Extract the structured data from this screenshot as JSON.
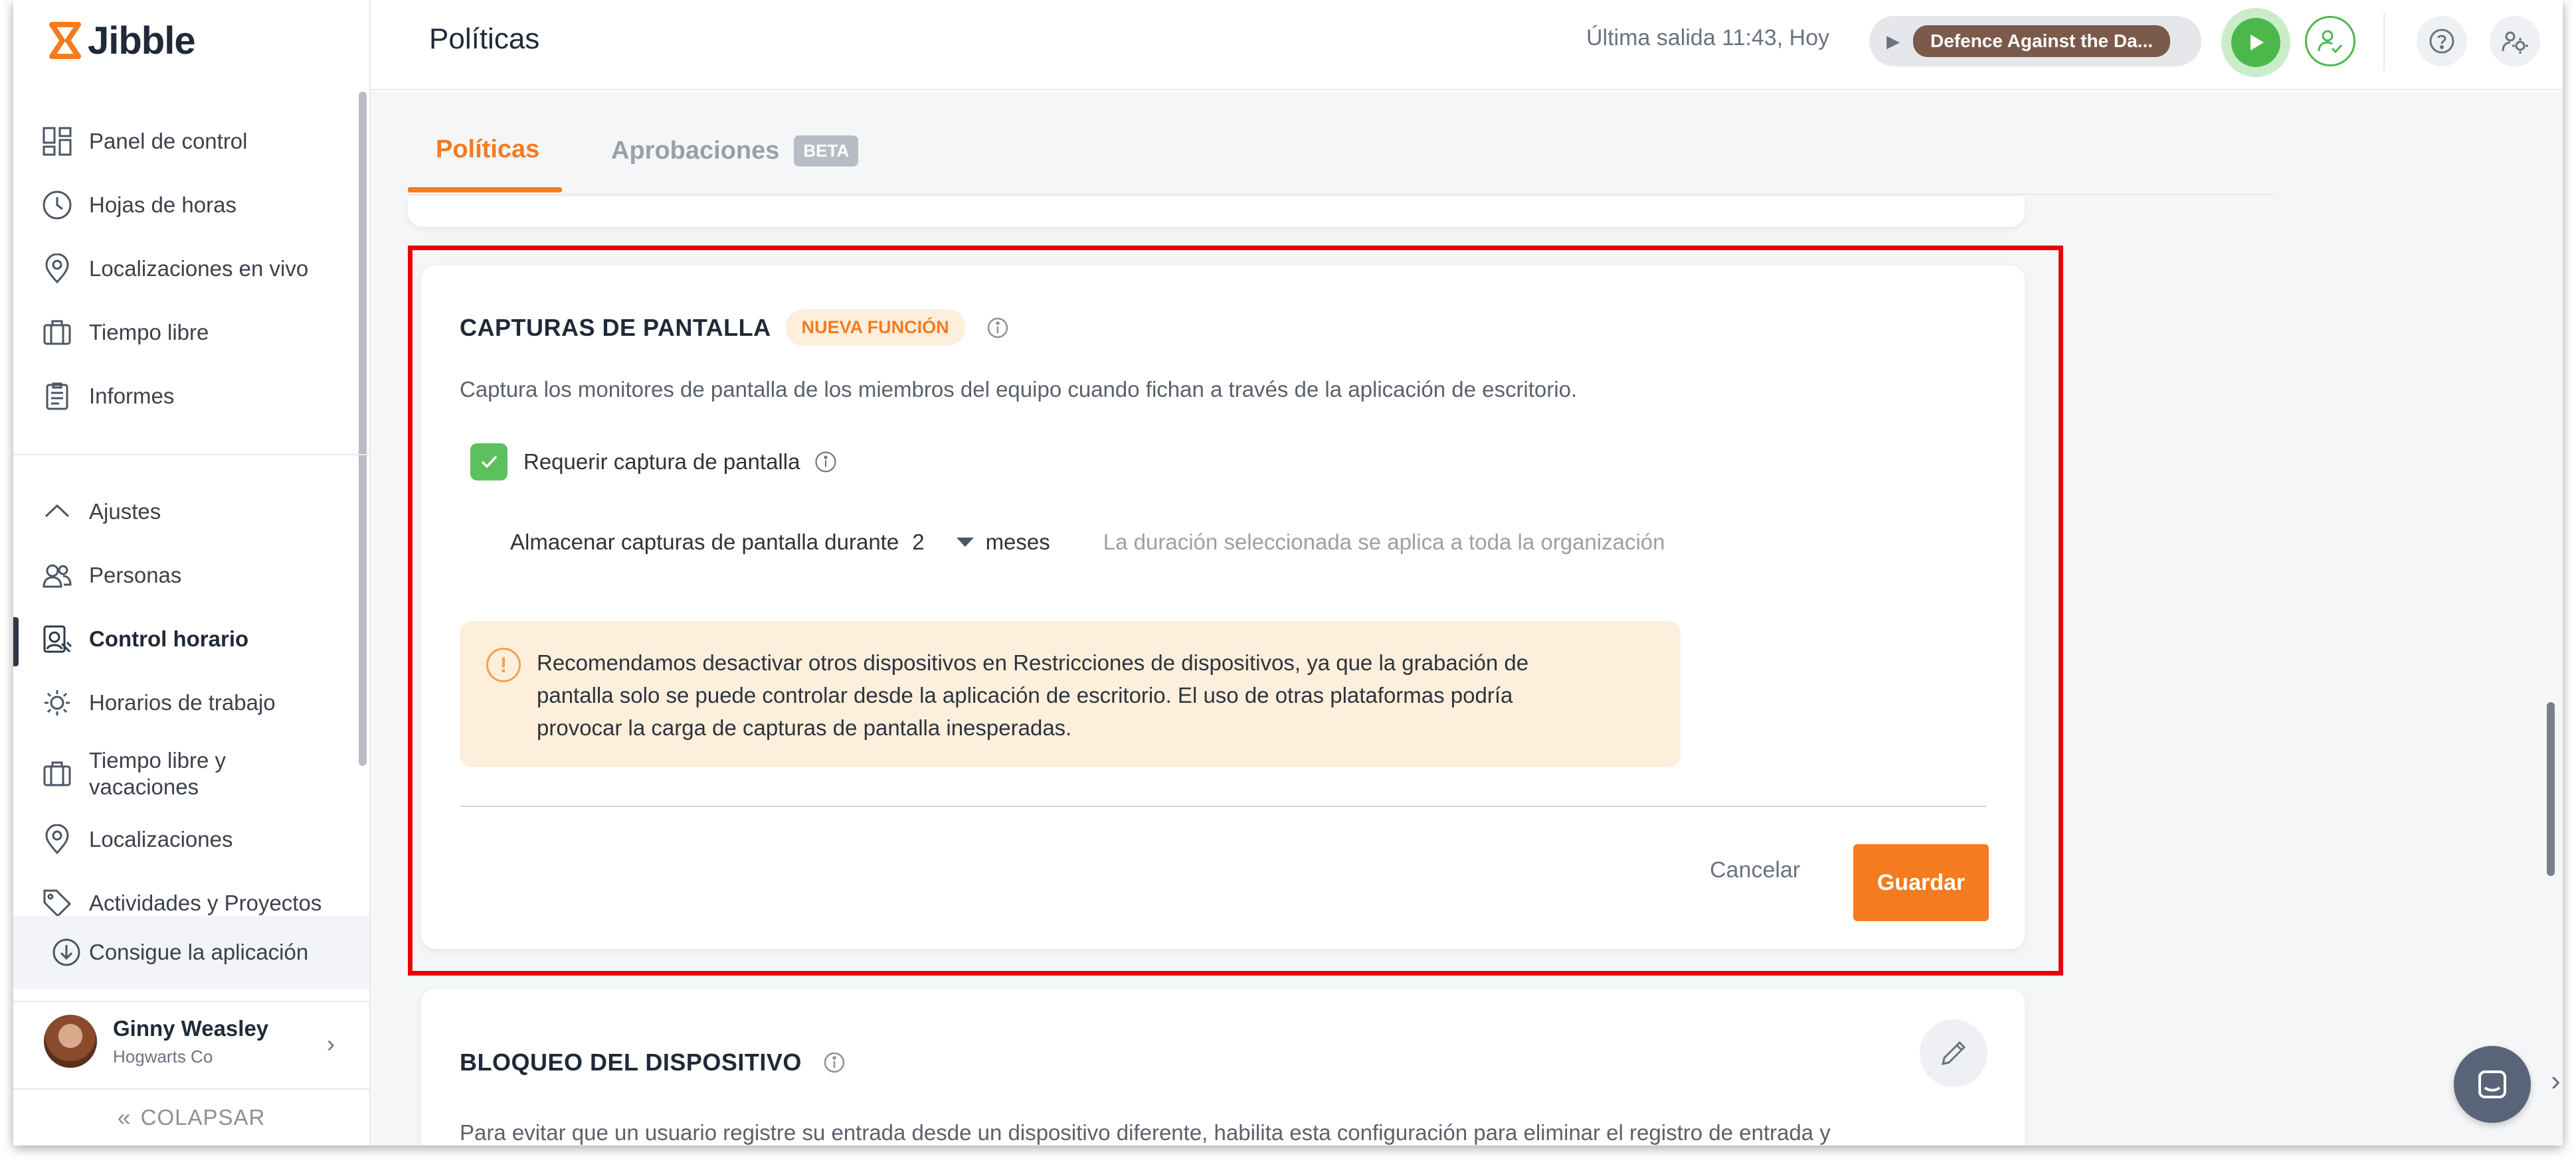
{
  "brand": {
    "name": "Jibble",
    "accent": "#f47b20"
  },
  "sidebar": {
    "items_top": [
      {
        "label": "Panel de control",
        "icon": "dashboard-icon"
      },
      {
        "label": "Hojas de horas",
        "icon": "clock-icon"
      },
      {
        "label": "Localizaciones en vivo",
        "icon": "location-pin-icon"
      },
      {
        "label": "Tiempo libre",
        "icon": "suitcase-icon"
      },
      {
        "label": "Informes",
        "icon": "clipboard-icon"
      }
    ],
    "items_settings": [
      {
        "label": "Ajustes",
        "icon": "chevron-up-icon"
      },
      {
        "label": "Personas",
        "icon": "people-icon"
      },
      {
        "label": "Control horario",
        "icon": "time-tracking-icon"
      },
      {
        "label": "Horarios de trabajo",
        "icon": "work-schedule-icon"
      },
      {
        "label": "Tiempo libre y vacaciones",
        "icon": "suitcase-icon"
      },
      {
        "label": "Localizaciones",
        "icon": "location-pin-icon"
      },
      {
        "label": "Actividades y Proyectos",
        "icon": "tag-icon"
      }
    ],
    "get_app": "Consigue la aplicación",
    "user": {
      "name": "Ginny Weasley",
      "org": "Hogwarts Co"
    },
    "collapse": "COLAPSAR"
  },
  "header": {
    "title": "Políticas",
    "last_out": "Última salida 11:43, Hoy",
    "activity": "Defence Against the Da..."
  },
  "tabs": [
    {
      "label": "Políticas",
      "active": true
    },
    {
      "label": "Aprobaciones",
      "badge": "BETA"
    }
  ],
  "screenshots_card": {
    "title": "CAPTURAS DE PANTALLA",
    "badge": "NUEVA FUNCIÓN",
    "description": "Captura los monitores de pantalla de los miembros del equipo cuando fichan a través de la aplicación de escritorio.",
    "checkbox_label": "Requerir captura de pantalla",
    "checkbox_checked": true,
    "store_label": "Almacenar capturas de pantalla durante",
    "store_value": "2",
    "store_unit": "meses",
    "store_note": "La duración seleccionada se aplica a toda la organización",
    "warning_lines": [
      "Recomendamos desactivar otros dispositivos en Restricciones de dispositivos, ya que la grabación de",
      "pantalla solo se puede controlar desde la aplicación de escritorio. El uso de otras plataformas podría",
      "provocar la carga de capturas de pantalla inesperadas."
    ],
    "cancel": "Cancelar",
    "save": "Guardar"
  },
  "device_lock_card": {
    "title": "BLOQUEO DEL DISPOSITIVO",
    "description": "Para evitar que un usuario registre su entrada desde un dispositivo diferente, habilita esta configuración para eliminar el registro de entrada y"
  }
}
